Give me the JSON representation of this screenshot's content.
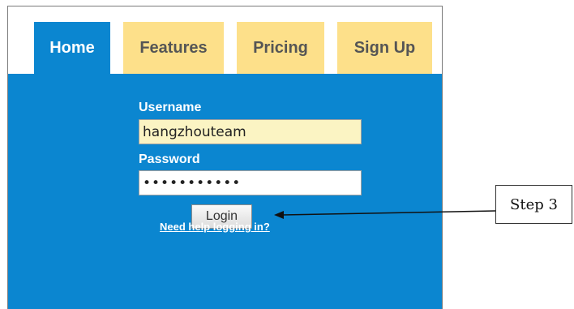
{
  "tabs": [
    {
      "label": "Home",
      "active": true
    },
    {
      "label": "Features",
      "active": false
    },
    {
      "label": "Pricing",
      "active": false
    },
    {
      "label": "Sign Up",
      "active": false
    }
  ],
  "login_form": {
    "username_label": "Username",
    "username_value": "hangzhouteam",
    "password_label": "Password",
    "password_value": "1234567890a",
    "login_button": "Login",
    "help_link": "Need help logging in?"
  },
  "annotation": {
    "callout_text": "Step 3"
  },
  "colors": {
    "panel_blue": "#0b86d0",
    "tab_yellow": "#fde08a",
    "username_bg": "#fbf4c3"
  }
}
